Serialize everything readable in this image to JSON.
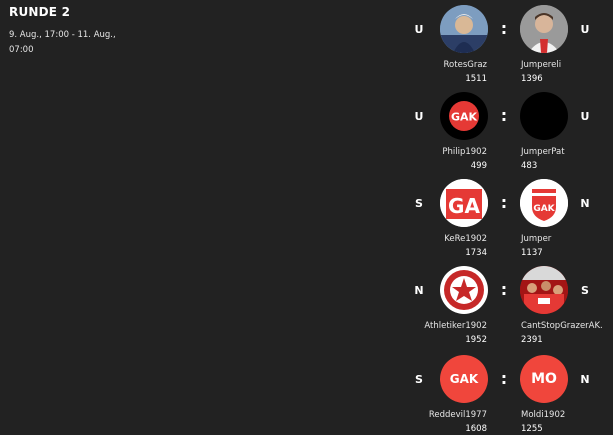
{
  "round": {
    "title": "RUNDE 2",
    "dates": "9. Aug., 17:00 - 11. Aug., 07:00"
  },
  "colon": ":",
  "matches": [
    {
      "left": {
        "result": "U",
        "name": "RotesGraz",
        "points": "1511"
      },
      "right": {
        "result": "U",
        "name": "Jumpereli",
        "points": "1396"
      }
    },
    {
      "left": {
        "result": "U",
        "name": "Philip1902",
        "points": "499",
        "badge": "GAK"
      },
      "right": {
        "result": "U",
        "name": "JumperPat",
        "points": "483"
      }
    },
    {
      "left": {
        "result": "S",
        "name": "KeRe1902",
        "points": "1734",
        "badge": "GA"
      },
      "right": {
        "result": "N",
        "name": "Jumper",
        "points": "1137",
        "badge": "GAK"
      }
    },
    {
      "left": {
        "result": "N",
        "name": "Athletiker1902",
        "points": "1952"
      },
      "right": {
        "result": "S",
        "name": "CantStopGrazerAK.",
        "points": "2391"
      }
    },
    {
      "left": {
        "result": "S",
        "name": "Reddevil1977",
        "points": "1608",
        "badge": "GAK"
      },
      "right": {
        "result": "N",
        "name": "Moldi1902",
        "points": "1255",
        "badge": "MO"
      }
    }
  ],
  "colors": {
    "background": "#222222",
    "red": "#e53935",
    "coral": "#f0463c"
  }
}
